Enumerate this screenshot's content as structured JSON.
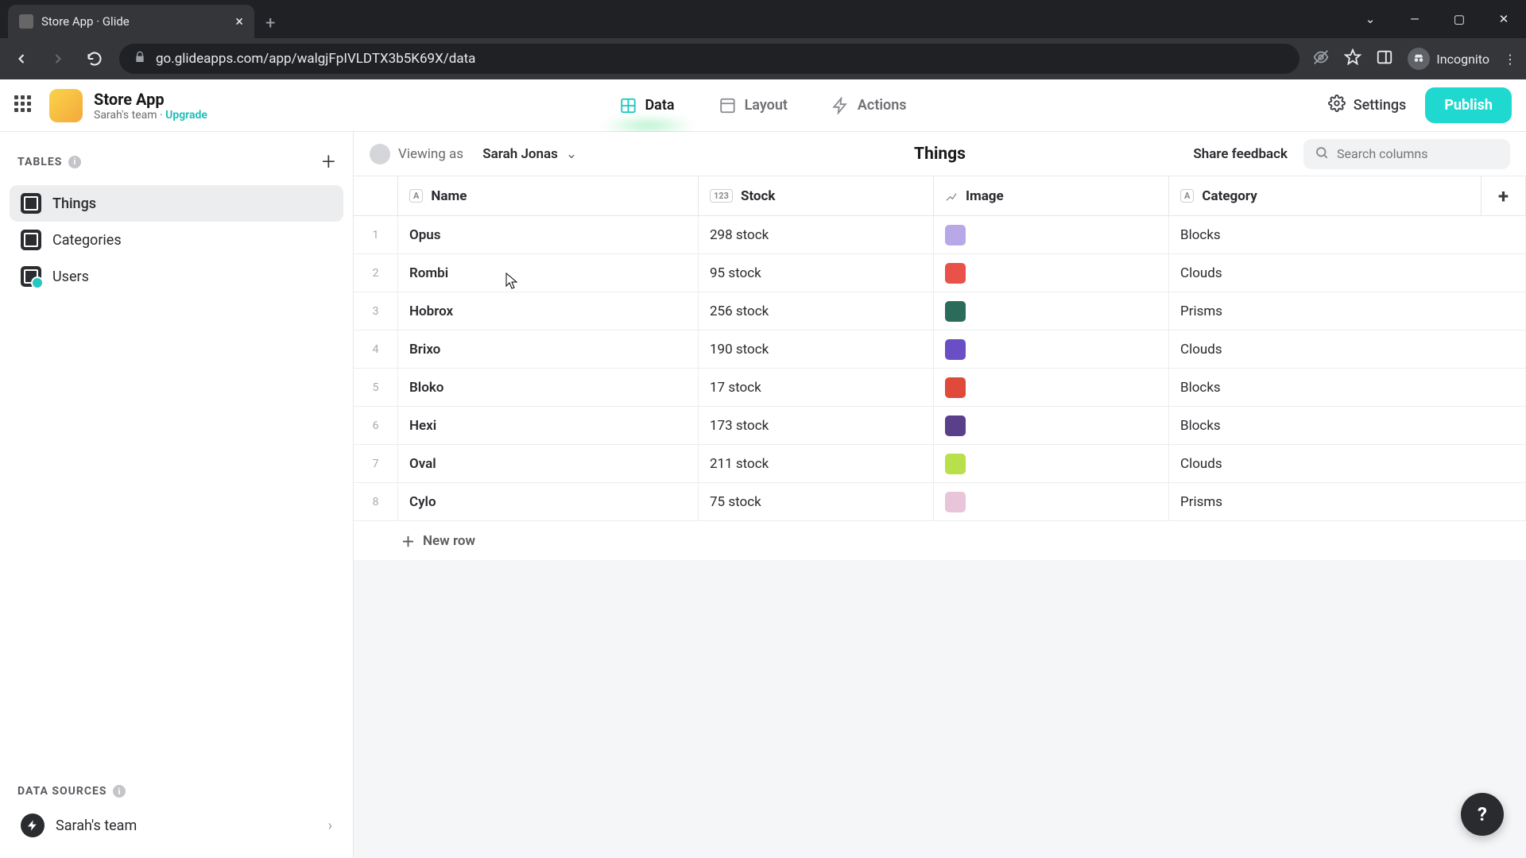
{
  "browser": {
    "tab_title": "Store App · Glide",
    "url": "go.glideapps.com/app/walgjFpIVLDTX3b5K69X/data",
    "incognito_label": "Incognito"
  },
  "header": {
    "app_title": "Store App",
    "team_name": "Sarah's team",
    "upgrade_label": "Upgrade",
    "tabs": [
      {
        "label": "Data",
        "active": true
      },
      {
        "label": "Layout",
        "active": false
      },
      {
        "label": "Actions",
        "active": false
      }
    ],
    "settings_label": "Settings",
    "publish_label": "Publish"
  },
  "sidebar": {
    "tables_label": "TABLES",
    "tables": [
      {
        "label": "Things",
        "active": true
      },
      {
        "label": "Categories",
        "active": false
      },
      {
        "label": "Users",
        "active": false,
        "badge": true
      }
    ],
    "data_sources_label": "DATA SOURCES",
    "data_source_item": "Sarah's team"
  },
  "content": {
    "viewer_prefix": "Viewing as",
    "viewer_name": "Sarah Jonas",
    "title": "Things",
    "feedback_label": "Share feedback",
    "search_placeholder": "Search columns",
    "columns": [
      {
        "label": "Name",
        "type": "A"
      },
      {
        "label": "Stock",
        "type": "123"
      },
      {
        "label": "Image",
        "type": "img"
      },
      {
        "label": "Category",
        "type": "A"
      }
    ],
    "rows": [
      {
        "name": "Opus",
        "stock": "298 stock",
        "image_color": "#b9a8e8",
        "category": "Blocks"
      },
      {
        "name": "Rombi",
        "stock": "95 stock",
        "image_color": "#e8524a",
        "category": "Clouds"
      },
      {
        "name": "Hobrox",
        "stock": "256 stock",
        "image_color": "#2a6b5a",
        "category": "Prisms"
      },
      {
        "name": "Brixo",
        "stock": "190 stock",
        "image_color": "#6a4fc4",
        "category": "Clouds"
      },
      {
        "name": "Bloko",
        "stock": "17 stock",
        "image_color": "#e04a3a",
        "category": "Blocks"
      },
      {
        "name": "Hexi",
        "stock": "173 stock",
        "image_color": "#5a3f8a",
        "category": "Blocks"
      },
      {
        "name": "Oval",
        "stock": "211 stock",
        "image_color": "#b8e04a",
        "category": "Clouds"
      },
      {
        "name": "Cylo",
        "stock": "75 stock",
        "image_color": "#e8c5d8",
        "category": "Prisms"
      }
    ],
    "new_row_label": "New row"
  }
}
